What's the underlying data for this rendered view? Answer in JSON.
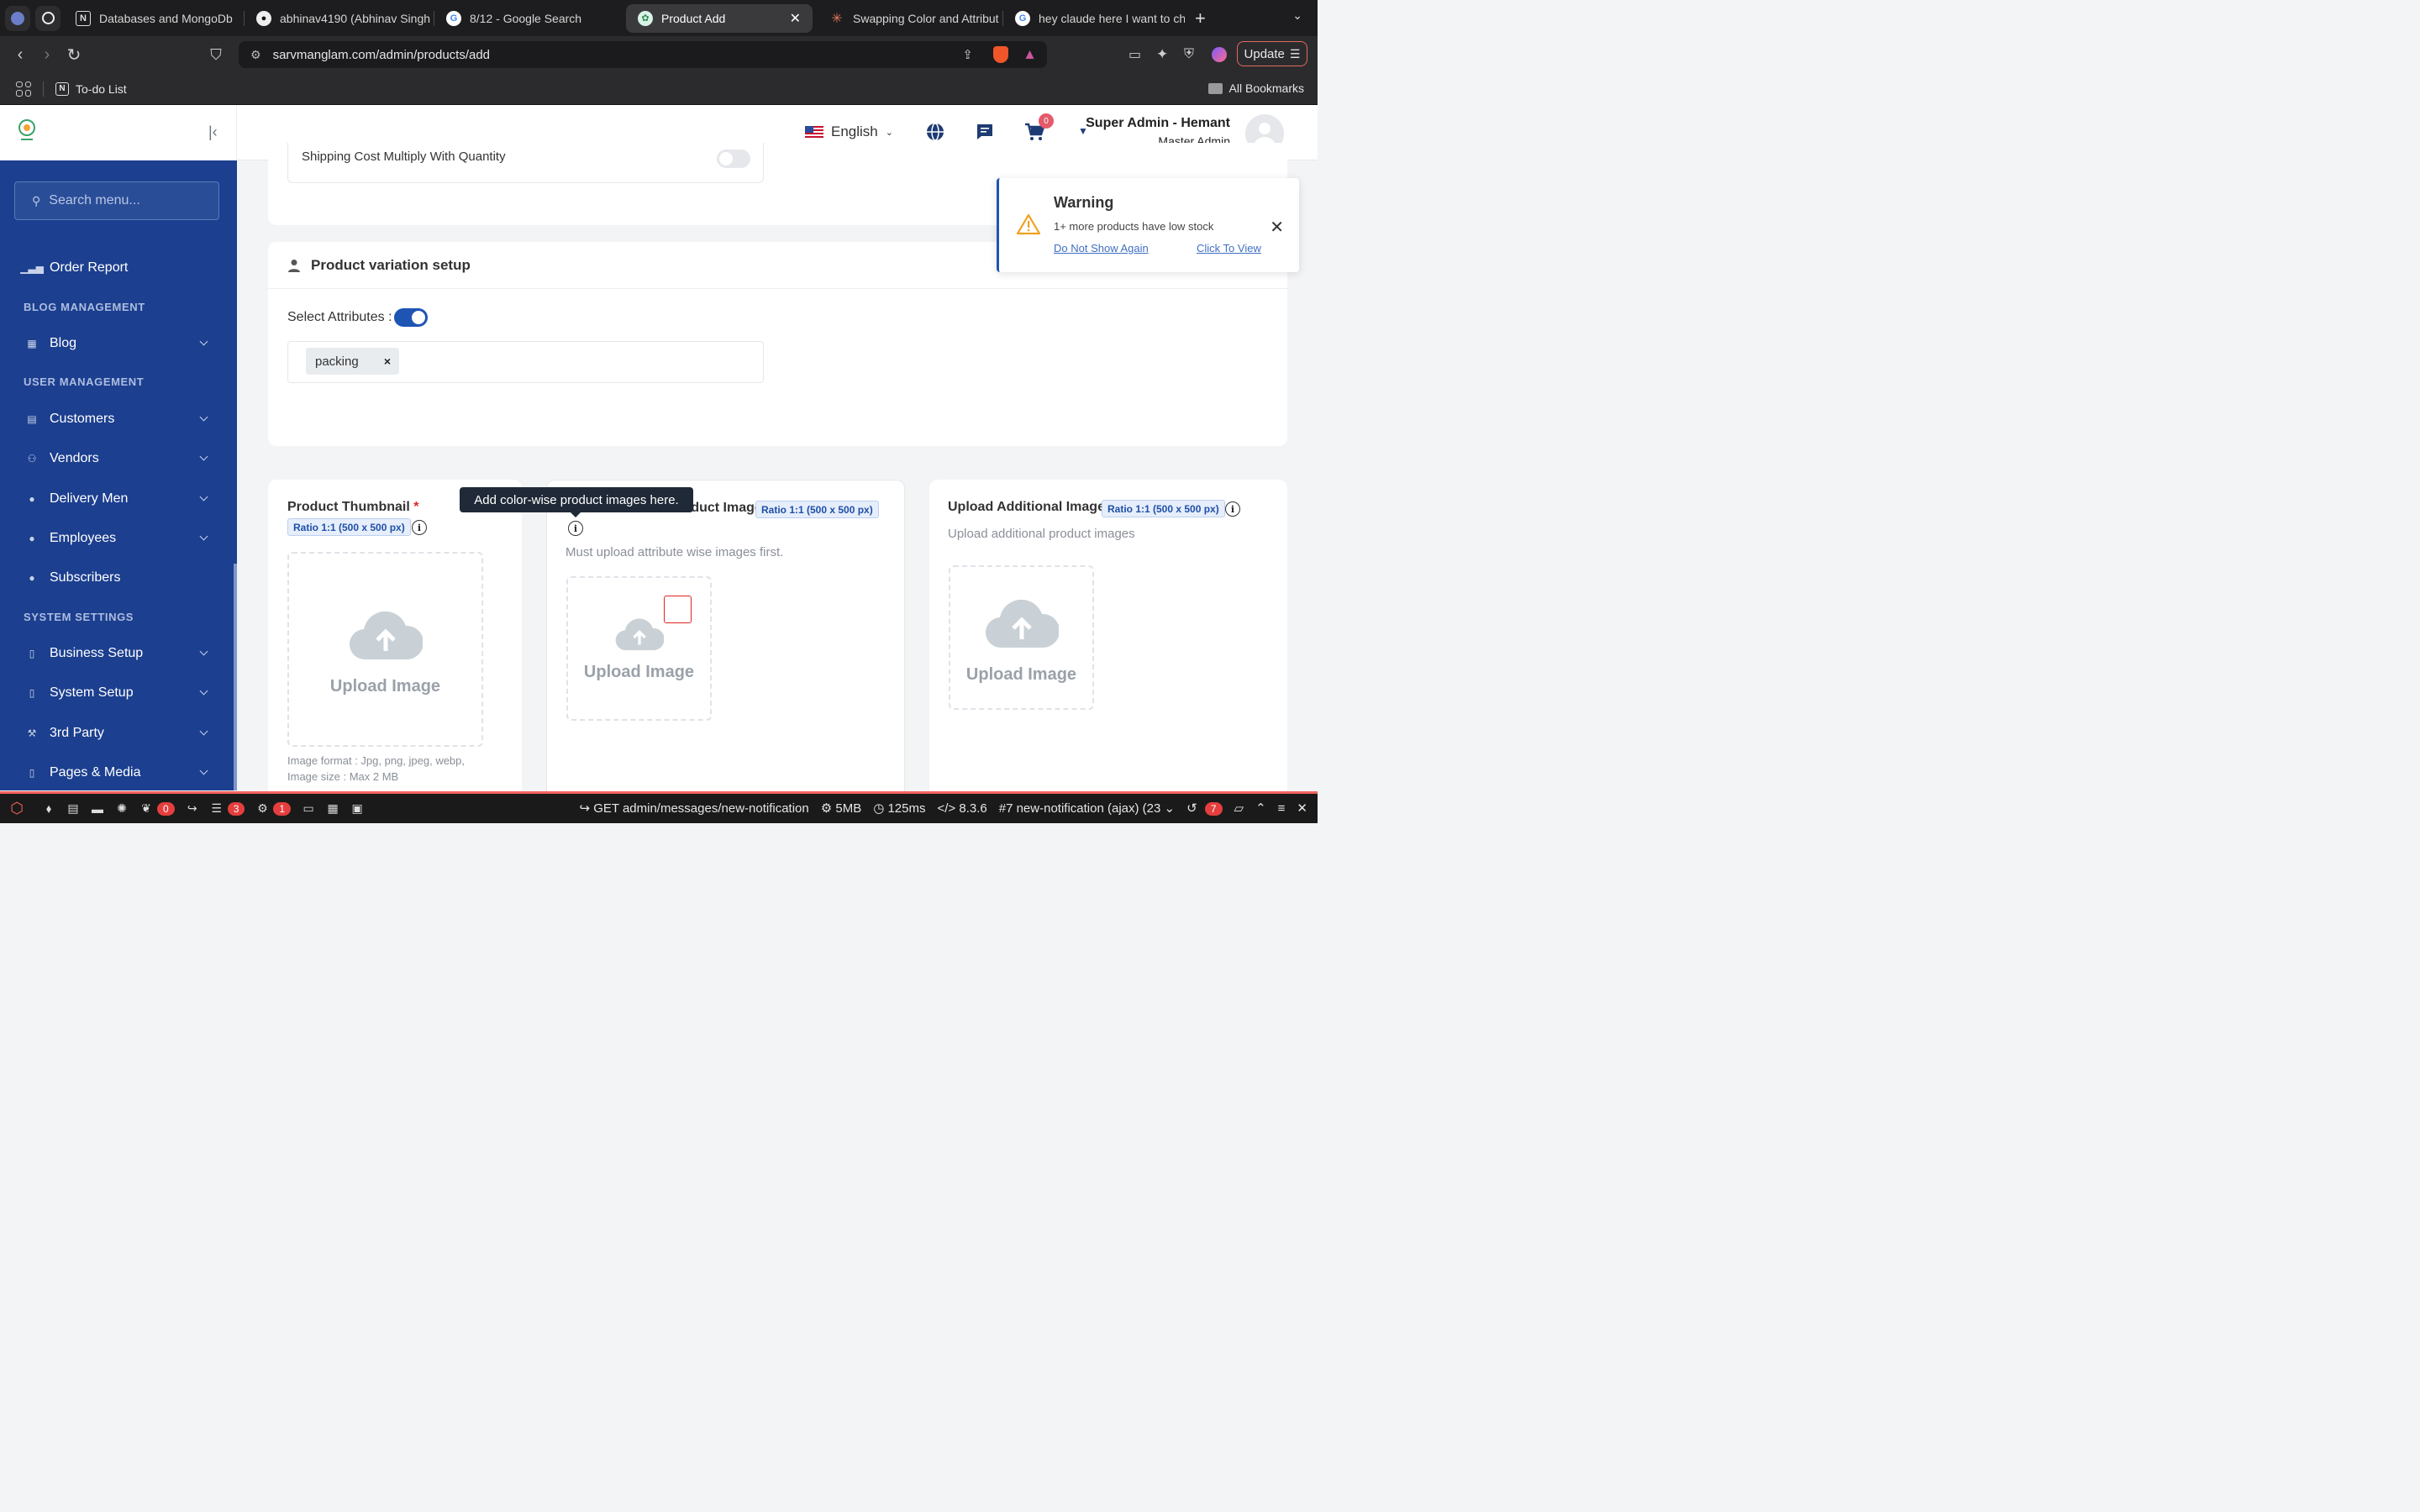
{
  "browser": {
    "tabs": [
      {
        "label": "Databases and MongoDb",
        "icon": "notion-icon"
      },
      {
        "label": "abhinav4190 (Abhinav Singh",
        "icon": "github-icon"
      },
      {
        "label": "8/12 - Google Search",
        "icon": "google-icon"
      },
      {
        "label": "Product Add",
        "icon": "site-icon",
        "active": true
      },
      {
        "label": "Swapping Color and Attribut",
        "icon": "claude-icon"
      },
      {
        "label": "hey claude here I want to ch",
        "icon": "google-icon"
      }
    ],
    "url_domain": "sarvmanglam.com",
    "url_path": "/admin/products/add",
    "update_label": "Update",
    "bookmark_todo": "To-do List",
    "all_bookmarks": "All Bookmarks"
  },
  "header": {
    "language": "English",
    "cart_count": "0",
    "user_name": "Super Admin - Hemant",
    "user_role": "Master Admin"
  },
  "sidebar": {
    "search_placeholder": "Search menu...",
    "order_report": "Order Report",
    "blog_heading": "BLOG MANAGEMENT",
    "blog": "Blog",
    "user_heading": "USER MANAGEMENT",
    "customers": "Customers",
    "vendors": "Vendors",
    "delivery_men": "Delivery Men",
    "employees": "Employees",
    "subscribers": "Subscribers",
    "system_heading": "SYSTEM SETTINGS",
    "business_setup": "Business Setup",
    "system_setup": "System Setup",
    "third_party": "3rd Party",
    "pages_media": "Pages & Media"
  },
  "main": {
    "shipping_label": "Shipping Cost Multiply With Quantity",
    "variation_title": "Product variation setup",
    "select_attributes": "Select Attributes :",
    "attribute_chip": "packing",
    "thumbnail_title": "Product Thumbnail",
    "required_mark": "*",
    "ratio": "Ratio 1:1 (500 x 500 px)",
    "upload_image": "Upload Image",
    "format_text": "Image format : Jpg, png, jpeg, webp,",
    "size_text": "Image size : Max 2 MB",
    "attr_title": "Attributes Wise Product Image",
    "attr_sub": "Must upload attribute wise images first.",
    "additional_title": "Upload Additional Image",
    "additional_sub": "Upload additional product images",
    "tooltip": "Add color-wise product images here."
  },
  "toast": {
    "title": "Warning",
    "message": "1+ more products have low stock",
    "dont_show": "Do Not Show Again",
    "click_view": "Click To View"
  },
  "debugbar": {
    "badge_1": "0",
    "badge_2": "3",
    "badge_3": "1",
    "request": "GET admin/messages/new-notification",
    "memory": "5MB",
    "time": "125ms",
    "version": "8.3.6",
    "ajax": "#7 new-notification (ajax) (23",
    "history_count": "7"
  },
  "colors": {
    "sidebar": "#1c3f8f",
    "accent": "#1e55b3",
    "debug_accent": "#f4645f"
  }
}
